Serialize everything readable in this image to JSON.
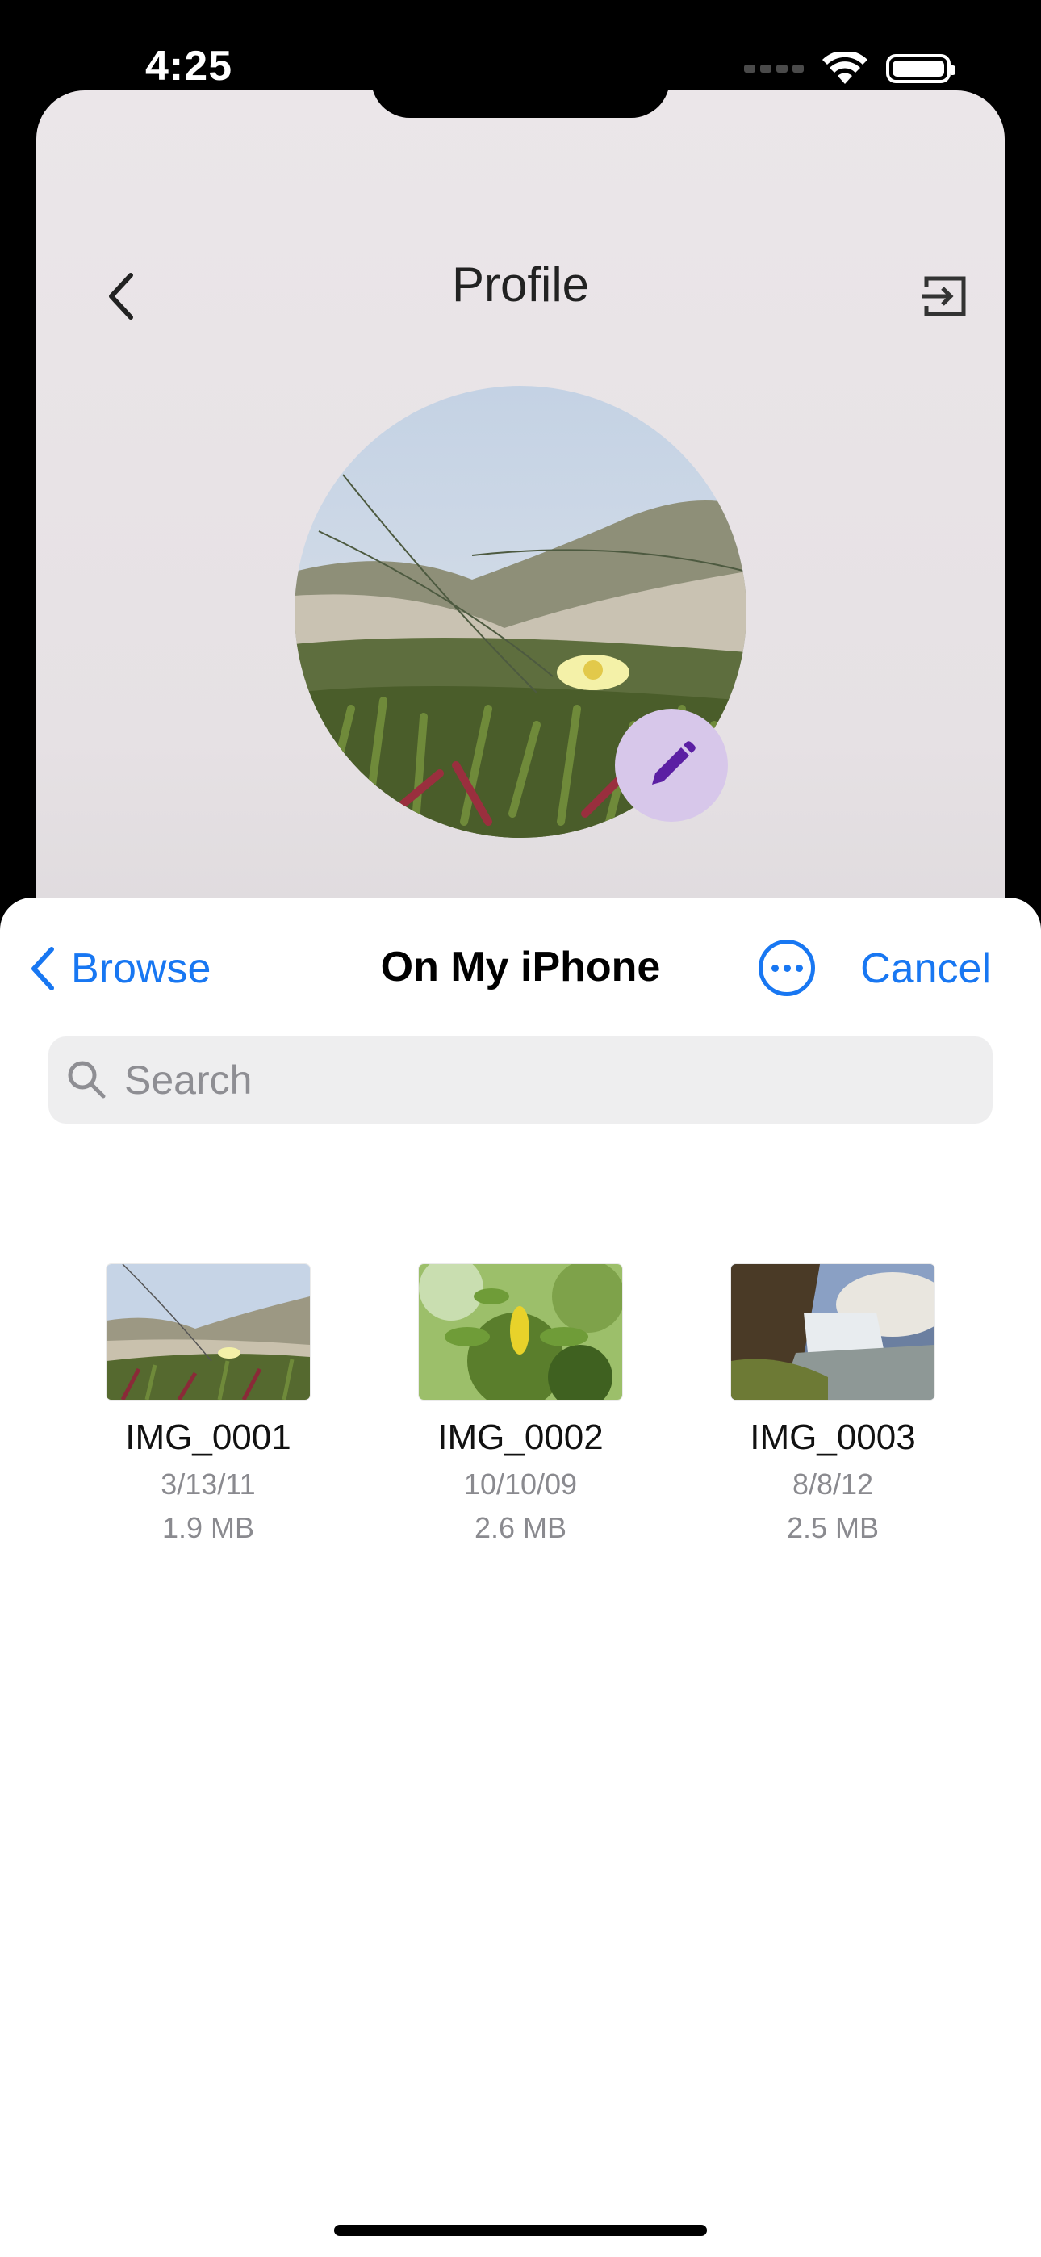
{
  "status_bar": {
    "time": "4:25"
  },
  "profile_screen": {
    "title": "Profile",
    "back_icon": "chevron-left-icon",
    "logout_icon": "logout-icon",
    "edit_icon": "pencil-icon"
  },
  "picker": {
    "back_label": "Browse",
    "title": "On My iPhone",
    "cancel_label": "Cancel",
    "search_placeholder": "Search",
    "accent_color": "#1877f2",
    "files": [
      {
        "name": "IMG_0001",
        "date": "3/13/11",
        "size": "1.9 MB"
      },
      {
        "name": "IMG_0002",
        "date": "10/10/09",
        "size": "2.6 MB"
      },
      {
        "name": "IMG_0003",
        "date": "8/8/12",
        "size": "2.5 MB"
      }
    ]
  }
}
